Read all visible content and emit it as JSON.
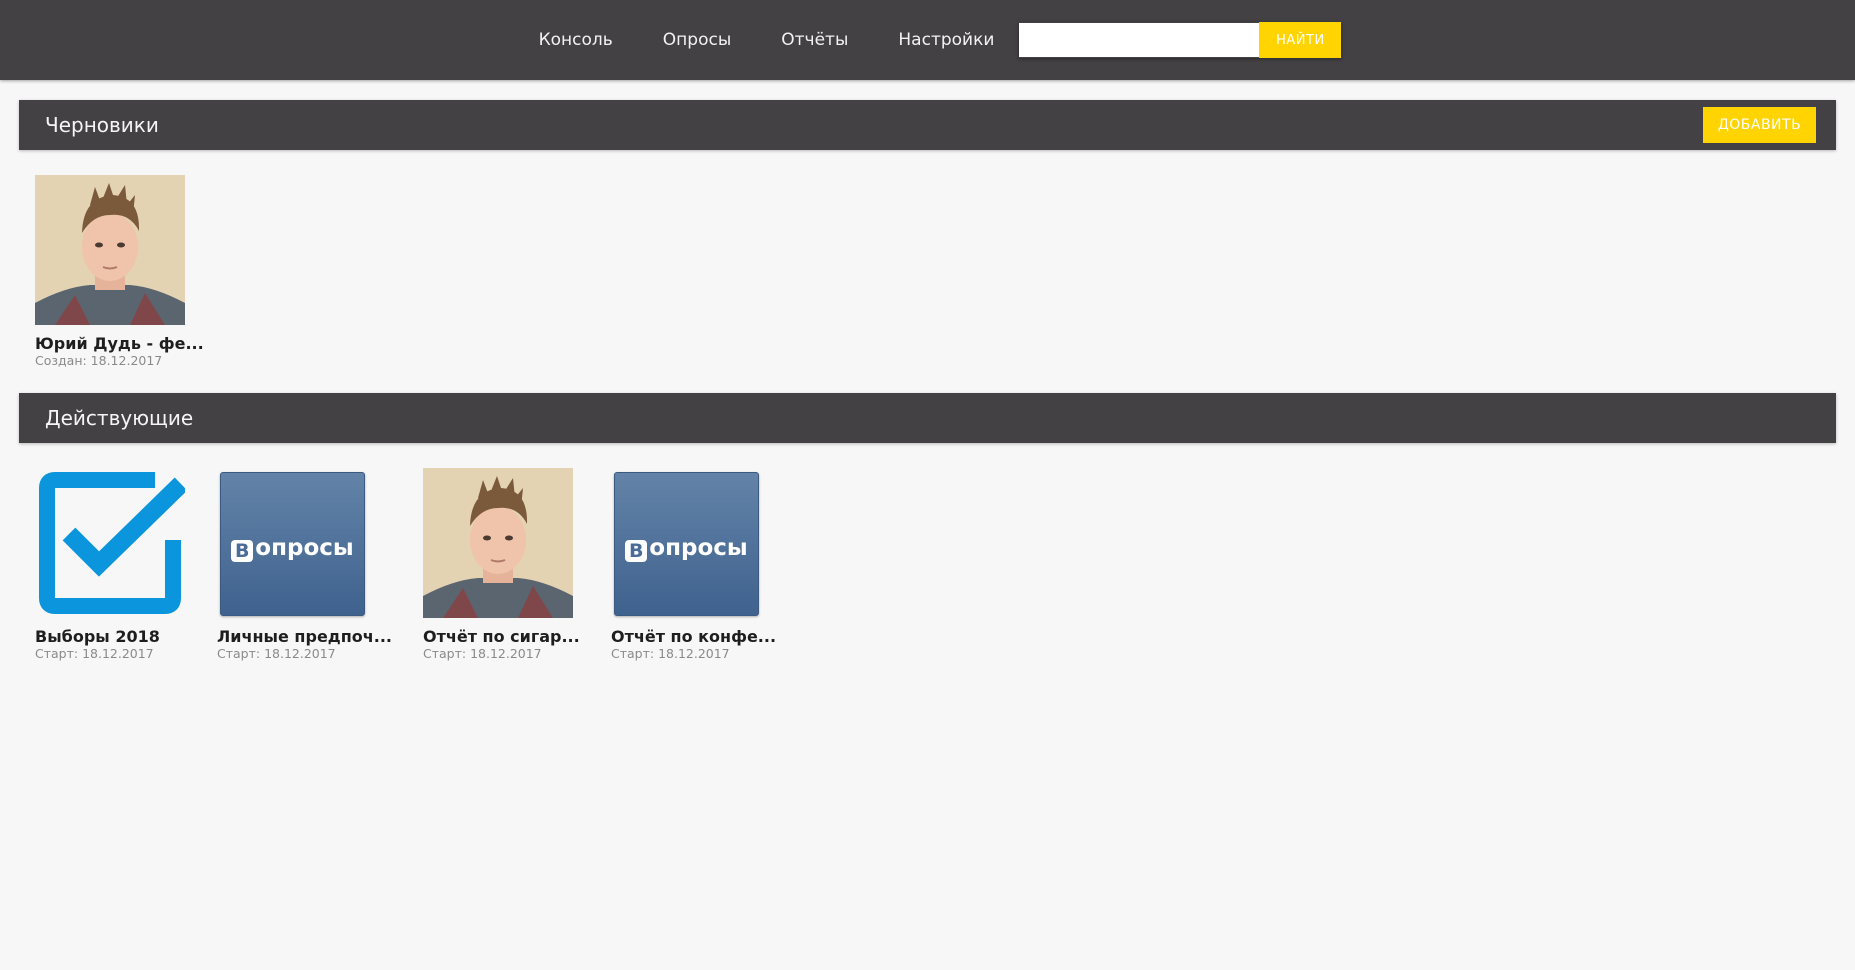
{
  "nav": {
    "items": [
      "Консоль",
      "Опросы",
      "Отчёты",
      "Настройки"
    ],
    "search_placeholder": "",
    "search_button": "НАЙТИ"
  },
  "drafts": {
    "title": "Черновики",
    "add_button": "ДОБАВИТЬ",
    "cards": [
      {
        "title": "Юрий Дудь - фе...",
        "date": "Создан: 18.12.2017",
        "image": "portrait"
      }
    ]
  },
  "active": {
    "title": "Действующие",
    "cards": [
      {
        "title": "Выборы 2018",
        "date": "Старт: 18.12.2017",
        "image": "checkbox"
      },
      {
        "title": "Личные предпоч...",
        "date": "Старт: 18.12.2017",
        "image": "vk"
      },
      {
        "title": "Отчёт по сигар...",
        "date": "Старт: 18.12.2017",
        "image": "portrait"
      },
      {
        "title": "Отчёт по конфе...",
        "date": "Старт: 18.12.2017",
        "image": "vk"
      }
    ]
  },
  "vk_logo": {
    "letter": "В",
    "text": "опросы"
  },
  "colors": {
    "accent": "#ffd400",
    "bar": "#434143",
    "check_blue": "#0a95dd",
    "vk_blue": "#4a6d98"
  }
}
